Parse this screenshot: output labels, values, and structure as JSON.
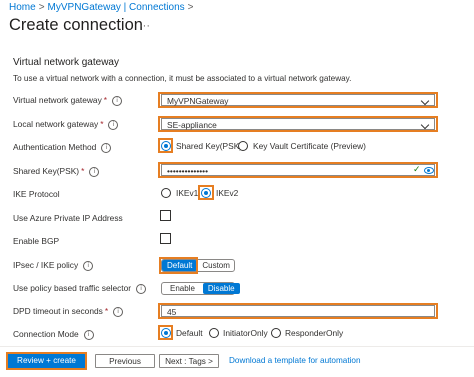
{
  "breadcrumb": {
    "items": [
      "Home",
      "MyVPNGateway | Connections"
    ],
    "separator": ">"
  },
  "page": {
    "title": "Create connection",
    "more_label": "···"
  },
  "section": {
    "heading": "Virtual network gateway",
    "description": "To use a virtual network with a connection, it must be associated to a virtual network gateway."
  },
  "fields": {
    "vng": {
      "label": "Virtual network gateway",
      "required_mark": "*",
      "value": "MyVPNGateway"
    },
    "lng": {
      "label": "Local network gateway",
      "required_mark": "*",
      "value": "SE-appliance"
    },
    "auth": {
      "label": "Authentication Method",
      "options": [
        "Shared Key(PSK)",
        "Key Vault Certificate (Preview)"
      ],
      "selected": "Shared Key(PSK)"
    },
    "psk": {
      "label": "Shared Key(PSK)",
      "required_mark": "*",
      "value": "••••••••••••••"
    },
    "ike": {
      "label": "IKE Protocol",
      "options": [
        "IKEv1",
        "IKEv2"
      ],
      "selected": "IKEv2"
    },
    "private_ip": {
      "label": "Use Azure Private IP Address",
      "checked": false
    },
    "bgp": {
      "label": "Enable BGP",
      "checked": false
    },
    "ipsec": {
      "label": "IPsec / IKE policy",
      "options": [
        "Default",
        "Custom"
      ],
      "selected": "Default"
    },
    "policy_selector": {
      "label": "Use policy based traffic selector",
      "options": [
        "Enable",
        "Disable"
      ],
      "selected": "Disable"
    },
    "dpd": {
      "label": "DPD timeout in seconds",
      "required_mark": "*",
      "value": "45"
    },
    "mode": {
      "label": "Connection Mode",
      "options": [
        "Default",
        "InitiatorOnly",
        "ResponderOnly"
      ],
      "selected": "Default"
    }
  },
  "info_glyph": "i",
  "footer": {
    "review": "Review + create",
    "previous": "Previous",
    "next": "Next : Tags >",
    "template_link": "Download a template for automation"
  },
  "colors": {
    "accent": "#0078d4",
    "highlight": "#e67e22",
    "required": "#a4262c",
    "valid": "#107c10"
  },
  "icons": {
    "info": "info-icon",
    "dropdown": "chevron-down-icon",
    "valid": "checkmark-icon",
    "reveal": "eye-icon"
  }
}
